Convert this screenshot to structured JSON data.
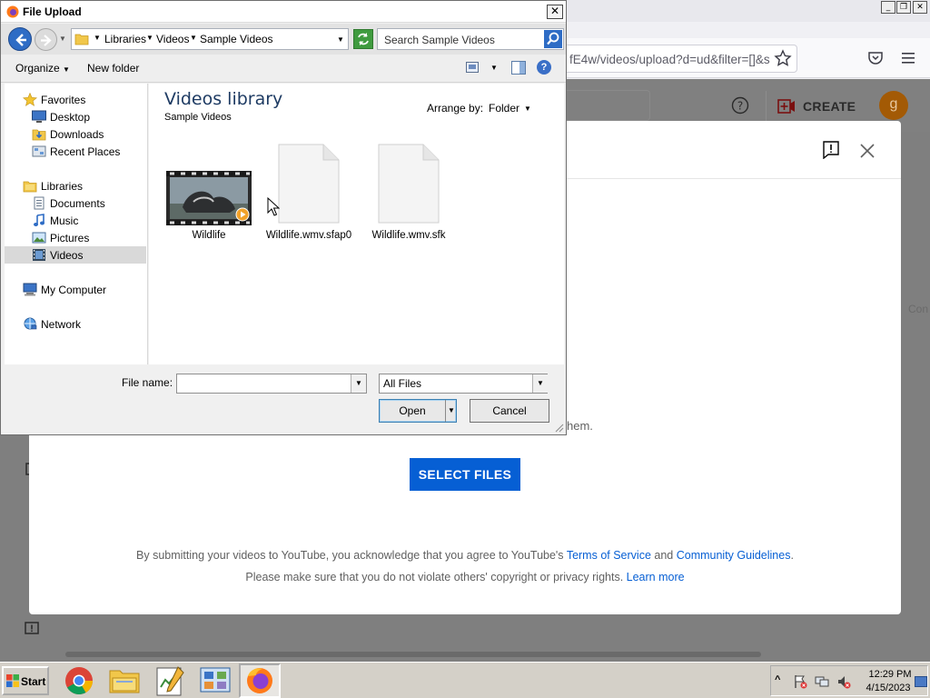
{
  "browser": {
    "url_visible": "fE4w/videos/upload?d=ud&filter=[]&s",
    "window_buttons": [
      "_",
      "❐",
      "✕"
    ]
  },
  "youtube": {
    "create_label": "CREATE",
    "avatar_letter": "g",
    "modal": {
      "partial_text": "hem.",
      "side_cut_text": "Con",
      "select_files_label": "SELECT FILES",
      "legal_line1_prefix": "By submitting your videos to YouTube, you acknowledge that you agree to YouTube's ",
      "legal_tos": "Terms of Service",
      "legal_and": " and ",
      "legal_guidelines": "Community Guidelines",
      "legal_period": ".",
      "legal_line2_prefix": "Please make sure that you do not violate others' copyright or privacy rights. ",
      "legal_learn_more": "Learn more"
    },
    "colors": {
      "accent_blue": "#065fd4",
      "avatar": "#a35a05"
    }
  },
  "dialog": {
    "title": "File Upload",
    "close_label": "✕",
    "breadcrumb": [
      "Libraries",
      "Videos",
      "Sample Videos"
    ],
    "search_placeholder": "Search Sample Videos",
    "commands": {
      "organize": "Organize",
      "new_folder": "New folder",
      "help": "?"
    },
    "nav": {
      "favorites": "Favorites",
      "desktop": "Desktop",
      "downloads": "Downloads",
      "recent_places": "Recent Places",
      "libraries": "Libraries",
      "documents": "Documents",
      "music": "Music",
      "pictures": "Pictures",
      "videos": "Videos",
      "my_computer": "My Computer",
      "network": "Network"
    },
    "library": {
      "title": "Videos library",
      "subtitle": "Sample Videos",
      "arrange_label": "Arrange by:",
      "arrange_value": "Folder"
    },
    "files": [
      {
        "name": "Wildlife",
        "icon": "video-thumbnail-icon"
      },
      {
        "name": "Wildlife.wmv.sfap0",
        "icon": "blank-file-icon"
      },
      {
        "name": "Wildlife.wmv.sfk",
        "icon": "blank-file-icon"
      }
    ],
    "file_name_label": "File name:",
    "file_name_value": "",
    "filter_value": "All Files",
    "open_label": "Open",
    "cancel_label": "Cancel"
  },
  "taskbar": {
    "start_label": "Start",
    "apps": [
      "chrome-icon",
      "file-explorer-icon",
      "notepad-icon",
      "control-panel-icon",
      "firefox-icon"
    ],
    "tray_expand": "^",
    "clock_time": "12:29 PM",
    "clock_date": "4/15/2023"
  }
}
